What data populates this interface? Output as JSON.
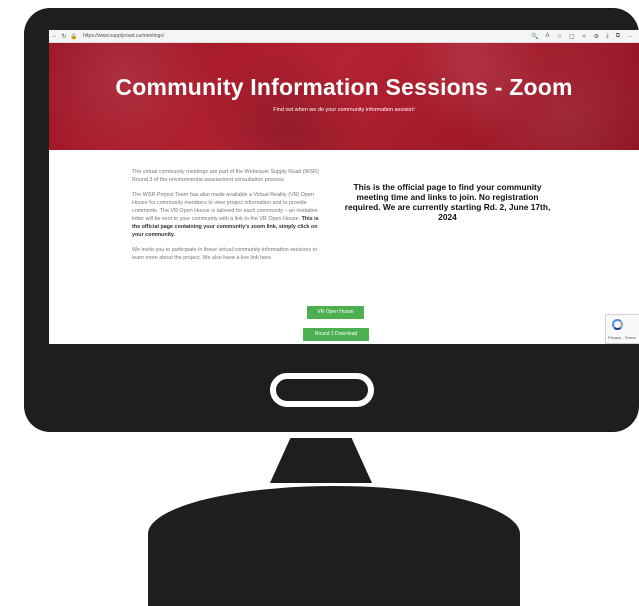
{
  "browser": {
    "back_glyph": "→",
    "reload_glyph": "↻",
    "lock_glyph": "🔒",
    "url": "https://www.supplyroad.ca/meetings/",
    "toolbar_icons": [
      "🔍",
      "A",
      "☆",
      "▢",
      "✧",
      "⚙",
      "⤓",
      "⧉",
      "…"
    ]
  },
  "hero": {
    "title": "Community Information Sessions - Zoom",
    "subtitle": "Find out when we do your community information session!"
  },
  "content": {
    "para1": "The virtual community meetings are part of the Webequie Supply Road (WSR) Round 3 of the environmental assessment consultation process.",
    "para2": "The WSR Project Team has also made available a Virtual Reality (VR) Open House for community members to view project information and to provide comments. The VR Open House is tailored for each community – an invitation letter will be sent to your community with a link to the VR Open House.",
    "para2_bold": "This is the official page containing your community's zoom link, simply click on your community.",
    "para3": "We invite you to participate in these virtual community information sessions to learn more about the project. We also have a live link here.",
    "callout": "This is the official page to find your community meeting time and links to join.  No registration required.  We are currently starting Rd. 2, June 17th, 2024",
    "btn_vr": "VR Open House",
    "btn_download": "Round 3 Download",
    "recaptcha": "Privacy - Terms"
  },
  "colors": {
    "hero_red": "#a81c2c",
    "button_green": "#4caf50",
    "monitor_frame": "#1e1e1e"
  }
}
